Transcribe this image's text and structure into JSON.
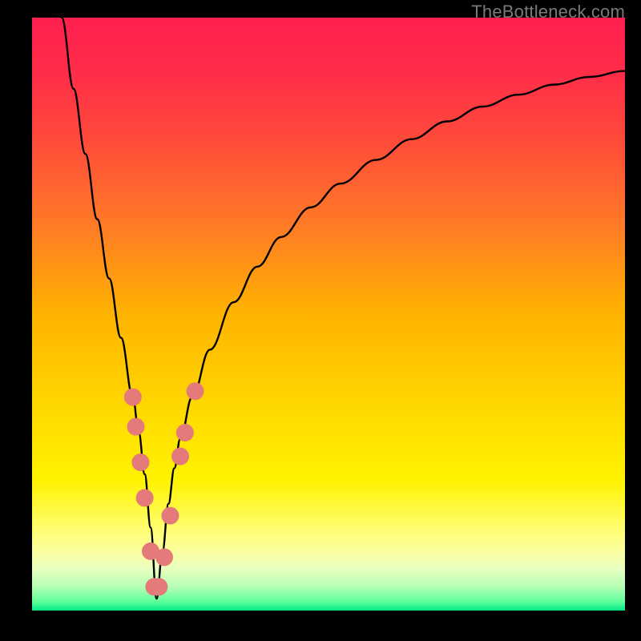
{
  "watermark": "TheBottleneck.com",
  "gradient": {
    "stops": [
      {
        "offset": 0.0,
        "color": "#ff1f4f"
      },
      {
        "offset": 0.1,
        "color": "#ff2e48"
      },
      {
        "offset": 0.22,
        "color": "#ff4f38"
      },
      {
        "offset": 0.35,
        "color": "#ff7a26"
      },
      {
        "offset": 0.5,
        "color": "#ffb300"
      },
      {
        "offset": 0.64,
        "color": "#ffd400"
      },
      {
        "offset": 0.78,
        "color": "#fff300"
      },
      {
        "offset": 0.85,
        "color": "#fffc60"
      },
      {
        "offset": 0.9,
        "color": "#fcffa0"
      },
      {
        "offset": 0.93,
        "color": "#e8ffc0"
      },
      {
        "offset": 0.96,
        "color": "#b5ffb5"
      },
      {
        "offset": 0.985,
        "color": "#5fff9a"
      },
      {
        "offset": 1.0,
        "color": "#00e886"
      }
    ]
  },
  "chart_data": {
    "type": "line",
    "title": "",
    "xlabel": "",
    "ylabel": "",
    "xlim": [
      0,
      100
    ],
    "ylim": [
      0,
      100
    ],
    "notch_x": 21,
    "series": [
      {
        "name": "bottleneck-curve",
        "x": [
          5,
          7,
          9,
          11,
          13,
          15,
          17,
          18,
          19,
          20,
          21,
          22,
          23,
          24,
          25,
          27,
          30,
          34,
          38,
          42,
          47,
          52,
          58,
          64,
          70,
          76,
          82,
          88,
          94,
          100
        ],
        "y": [
          100,
          88,
          77,
          66,
          56,
          46,
          36,
          30,
          23,
          14,
          2,
          10,
          18,
          24,
          29,
          36,
          44,
          52,
          58,
          63,
          68,
          72,
          76,
          79.5,
          82.5,
          85,
          87,
          88.7,
          90,
          91
        ]
      }
    ],
    "markers": {
      "name": "highlight-dots",
      "color": "#e47a7a",
      "radius_px": 11,
      "points": [
        {
          "x": 17.0,
          "y": 36
        },
        {
          "x": 17.5,
          "y": 31
        },
        {
          "x": 18.3,
          "y": 25
        },
        {
          "x": 19.0,
          "y": 19
        },
        {
          "x": 20.0,
          "y": 10
        },
        {
          "x": 20.6,
          "y": 4
        },
        {
          "x": 21.4,
          "y": 4
        },
        {
          "x": 22.3,
          "y": 9
        },
        {
          "x": 23.3,
          "y": 16
        },
        {
          "x": 25.0,
          "y": 26
        },
        {
          "x": 25.8,
          "y": 30
        },
        {
          "x": 27.5,
          "y": 37
        }
      ]
    }
  }
}
